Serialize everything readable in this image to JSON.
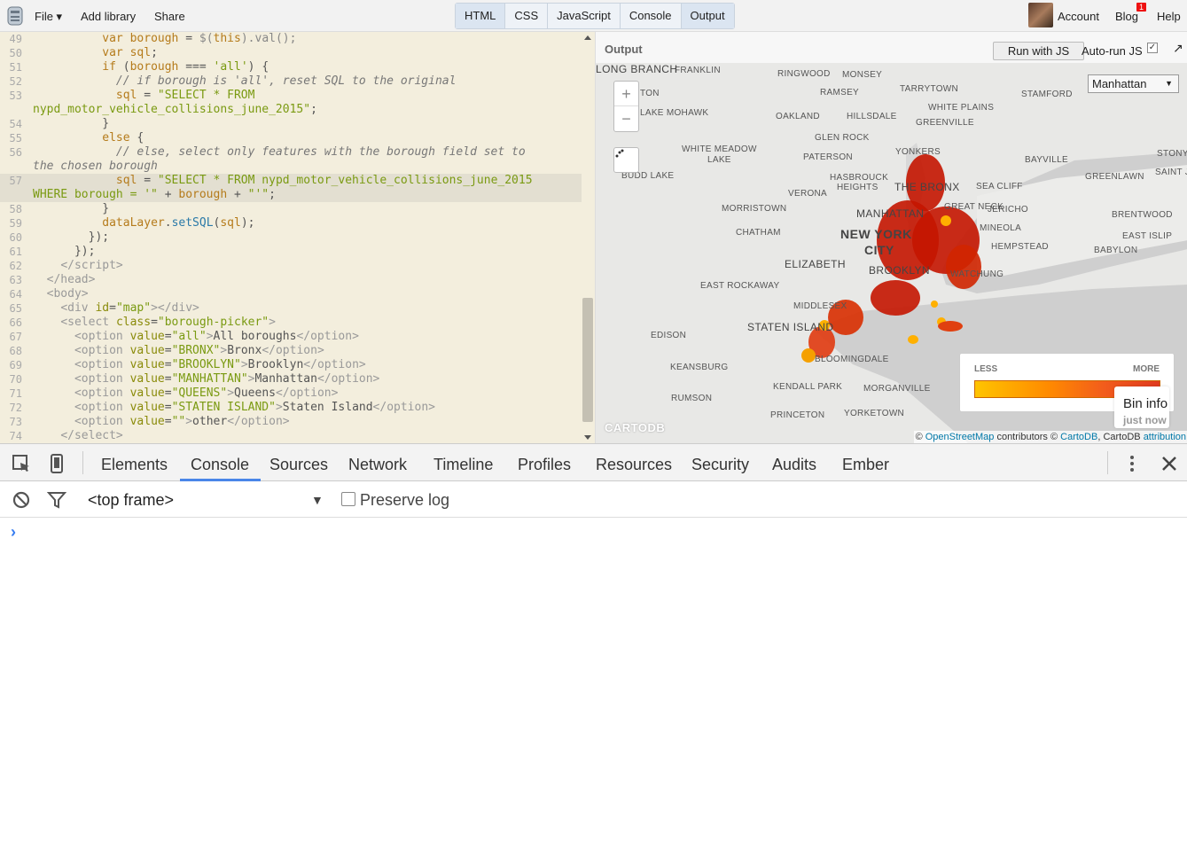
{
  "topbar": {
    "menu": [
      "File ▾",
      "Add library",
      "Share"
    ],
    "tabs": [
      "HTML",
      "CSS",
      "JavaScript",
      "Console",
      "Output"
    ],
    "account": "Account",
    "blog": "Blog",
    "blog_badge": "1",
    "help": "Help"
  },
  "editor": {
    "lines": [
      {
        "n": "49",
        "html": "          <span class='kw'>var</span> <span class='kw'>borough</span> = <span class='pl'>$(</span><span class='kw'>this</span><span class='pl'>).</span><span class='pl'>val</span><span class='pl'>();</span>"
      },
      {
        "n": "50",
        "html": "          <span class='kw'>var</span> <span class='kw'>sql</span>;"
      },
      {
        "n": "51",
        "html": "          <span class='kw'>if</span> (<span class='kw'>borough</span> === <span class='str'>'all'</span>) {"
      },
      {
        "n": "52",
        "html": "            <span class='cm'>// if borough is 'all', reset SQL to the original</span>"
      },
      {
        "n": "53",
        "html": "            <span class='kw'>sql</span> = <span class='str'>\"SELECT * FROM</span>"
      },
      {
        "n": "",
        "html": "<span class='str'>nypd_motor_vehicle_collisions_june_2015\"</span>;"
      },
      {
        "n": "54",
        "html": "          }"
      },
      {
        "n": "55",
        "html": "          <span class='kw'>else</span> {"
      },
      {
        "n": "56",
        "html": "            <span class='cm'>// else, select only features with the borough field set to</span>"
      },
      {
        "n": "",
        "html": "<span class='cm'>the chosen borough</span>"
      },
      {
        "n": "57",
        "html": "            <span class='kw'>sql</span> = <span class='str'>\"SELECT * FROM nypd_motor_vehicle_collisions_june_2015</span>",
        "hl": true
      },
      {
        "n": "",
        "html": "<span class='str'>WHERE borough = '\"</span> + <span class='kw'>borough</span> + <span class='str'>\"'\"</span>;",
        "hl": true
      },
      {
        "n": "58",
        "html": "          }"
      },
      {
        "n": "59",
        "html": "          <span class='kw'>dataLayer</span>.<span class='fn'>setSQL</span>(<span class='kw'>sql</span>);"
      },
      {
        "n": "60",
        "html": "        });"
      },
      {
        "n": "61",
        "html": "      });"
      },
      {
        "n": "62",
        "html": "    <span class='tg'>&lt;/script&gt;</span>"
      },
      {
        "n": "63",
        "html": "  <span class='tg'>&lt;/head&gt;</span>"
      },
      {
        "n": "64",
        "html": "  <span class='tg'>&lt;body&gt;</span>"
      },
      {
        "n": "65",
        "html": "    <span class='tg'>&lt;div</span> <span class='at'>id</span>=<span class='str'>\"map\"</span><span class='tg'>&gt;&lt;/div&gt;</span>"
      },
      {
        "n": "66",
        "html": "    <span class='tg'>&lt;select</span> <span class='at'>class</span>=<span class='str'>\"borough-picker\"</span><span class='tg'>&gt;</span>"
      },
      {
        "n": "67",
        "html": "      <span class='tg'>&lt;option</span> <span class='at'>value</span>=<span class='str'>\"all\"</span><span class='tg'>&gt;</span>All boroughs<span class='tg'>&lt;/option&gt;</span>"
      },
      {
        "n": "68",
        "html": "      <span class='tg'>&lt;option</span> <span class='at'>value</span>=<span class='str'>\"BRONX\"</span><span class='tg'>&gt;</span>Bronx<span class='tg'>&lt;/option&gt;</span>"
      },
      {
        "n": "69",
        "html": "      <span class='tg'>&lt;option</span> <span class='at'>value</span>=<span class='str'>\"BROOKLYN\"</span><span class='tg'>&gt;</span>Brooklyn<span class='tg'>&lt;/option&gt;</span>"
      },
      {
        "n": "70",
        "html": "      <span class='tg'>&lt;option</span> <span class='at'>value</span>=<span class='str'>\"MANHATTAN\"</span><span class='tg'>&gt;</span>Manhattan<span class='tg'>&lt;/option&gt;</span>"
      },
      {
        "n": "71",
        "html": "      <span class='tg'>&lt;option</span> <span class='at'>value</span>=<span class='str'>\"QUEENS\"</span><span class='tg'>&gt;</span>Queens<span class='tg'>&lt;/option&gt;</span>"
      },
      {
        "n": "72",
        "html": "      <span class='tg'>&lt;option</span> <span class='at'>value</span>=<span class='str'>\"STATEN ISLAND\"</span><span class='tg'>&gt;</span>Staten Island<span class='tg'>&lt;/option&gt;</span>"
      },
      {
        "n": "73",
        "html": "      <span class='tg'>&lt;option</span> <span class='at'>value</span>=<span class='str'>\"\"</span><span class='tg'>&gt;</span>other<span class='tg'>&lt;/option&gt;</span>"
      },
      {
        "n": "74",
        "html": "    <span class='tg'>&lt;/select&gt;</span>"
      }
    ]
  },
  "output": {
    "title": "Output",
    "run_button": "Run with JS",
    "autorun_label": "Auto-run JS",
    "autorun_checked": "✓",
    "popout": "↗",
    "borough_select": "Manhattan",
    "legend": {
      "less": "LESS",
      "more": "MORE"
    },
    "bin_info": {
      "title": "Bin info",
      "time": "just now"
    },
    "carto_logo": "CARTODB",
    "attribution": {
      "prefix": "© ",
      "osm": "OpenStreetMap",
      "mid": " contributors © ",
      "cartodb": "CartoDB",
      "mid2": ", CartoDB ",
      "attr": "attribution"
    },
    "places": [
      {
        "name": "FRANKLIN",
        "cls": ""
      },
      {
        "name": "RINGWOOD",
        "cls": ""
      },
      {
        "name": "MONSEY",
        "cls": ""
      },
      {
        "name": "TARRYTOWN",
        "cls": ""
      },
      {
        "name": "STAMFORD",
        "cls": ""
      },
      {
        "name": "TON",
        "cls": ""
      },
      {
        "name": "RAMSEY",
        "cls": ""
      },
      {
        "name": "LAKE MOHAWK",
        "cls": ""
      },
      {
        "name": "OAKLAND",
        "cls": ""
      },
      {
        "name": "HILLSDALE",
        "cls": ""
      },
      {
        "name": "WHITE PLAINS",
        "cls": ""
      },
      {
        "name": "GREENVILLE",
        "cls": ""
      },
      {
        "name": "GLEN ROCK",
        "cls": ""
      },
      {
        "name": "WHITE MEADOW",
        "cls": ""
      },
      {
        "name": "LAKE",
        "cls": ""
      },
      {
        "name": "YONKERS",
        "cls": ""
      },
      {
        "name": "STONY BROO",
        "cls": ""
      },
      {
        "name": "BAYVILLE",
        "cls": ""
      },
      {
        "name": "PATERSON",
        "cls": ""
      },
      {
        "name": "HASBROUCK",
        "cls": ""
      },
      {
        "name": "HEIGHTS",
        "cls": ""
      },
      {
        "name": "THE BRONX",
        "cls": "med"
      },
      {
        "name": "SEA CLIFF",
        "cls": ""
      },
      {
        "name": "GREENLAWN",
        "cls": ""
      },
      {
        "name": "SAINT JAMES",
        "cls": ""
      },
      {
        "name": "BUDD LAKE",
        "cls": ""
      },
      {
        "name": "VERONA",
        "cls": ""
      },
      {
        "name": "MORRISTOWN",
        "cls": ""
      },
      {
        "name": "GREAT NECK",
        "cls": ""
      },
      {
        "name": "JERICHO",
        "cls": ""
      },
      {
        "name": "MANHATTAN",
        "cls": "med"
      },
      {
        "name": "BRENTWOOD",
        "cls": ""
      },
      {
        "name": "CHATHAM",
        "cls": ""
      },
      {
        "name": "MINEOLA",
        "cls": ""
      },
      {
        "name": "NEW YORK",
        "cls": "big"
      },
      {
        "name": "EAST ISLIP",
        "cls": ""
      },
      {
        "name": "CITY",
        "cls": "big"
      },
      {
        "name": "HEMPSTEAD",
        "cls": ""
      },
      {
        "name": "BABYLON",
        "cls": ""
      },
      {
        "name": "ELIZABETH",
        "cls": "med"
      },
      {
        "name": "BROOKLYN",
        "cls": "med"
      },
      {
        "name": "WATCHUNG",
        "cls": ""
      },
      {
        "name": "EAST ROCKAWAY",
        "cls": ""
      },
      {
        "name": "MIDDLESEX",
        "cls": ""
      },
      {
        "name": "STATEN ISLAND",
        "cls": "med"
      },
      {
        "name": "EDISON",
        "cls": ""
      },
      {
        "name": "BLOOMINGDALE",
        "cls": ""
      },
      {
        "name": "KEANSBURG",
        "cls": ""
      },
      {
        "name": "KENDALL PARK",
        "cls": ""
      },
      {
        "name": "MORGANVILLE",
        "cls": ""
      },
      {
        "name": "RUMSON",
        "cls": ""
      },
      {
        "name": "PRINCETON",
        "cls": ""
      },
      {
        "name": "YORKETOWN",
        "cls": ""
      },
      {
        "name": "LONG BRANCH",
        "cls": "med"
      }
    ]
  },
  "devtools": {
    "tabs": [
      "Elements",
      "Console",
      "Sources",
      "Network",
      "Timeline",
      "Profiles",
      "Resources",
      "Security",
      "Audits",
      "Ember"
    ],
    "frame": "<top frame>",
    "frame_caret": "▼",
    "preserve_log": "Preserve log",
    "prompt": "›"
  },
  "colors": {
    "heat_dark": "#c41500",
    "heat_mid": "#e03a10",
    "heat_light": "#ffb000",
    "water": "#c9c9c9"
  }
}
